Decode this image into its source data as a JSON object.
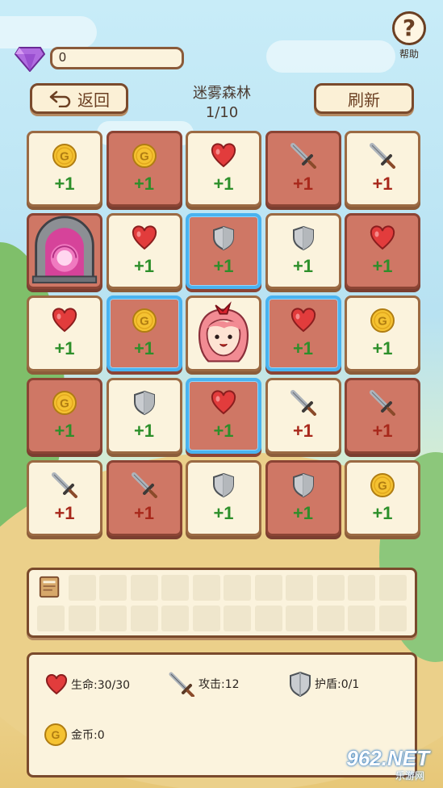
{
  "header": {
    "gems": "0",
    "help_label": "帮助",
    "back_label": "返回",
    "refresh_label": "刷新",
    "level_name": "迷雾森林",
    "level_progress": "1/10"
  },
  "grid": {
    "rows": [
      [
        {
          "icon": "coin-icon",
          "value": "+1",
          "tone": "light",
          "selected": false,
          "kind": "good"
        },
        {
          "icon": "coin-icon",
          "value": "+1",
          "tone": "dark",
          "selected": false,
          "kind": "good"
        },
        {
          "icon": "heart-icon",
          "value": "+1",
          "tone": "light",
          "selected": false,
          "kind": "good"
        },
        {
          "icon": "sword-icon",
          "value": "+1",
          "tone": "dark",
          "selected": false,
          "kind": "bad"
        },
        {
          "icon": "sword-icon",
          "value": "+1",
          "tone": "light",
          "selected": false,
          "kind": "bad"
        }
      ],
      [
        {
          "icon": "portal-icon",
          "value": "",
          "tone": "dark",
          "selected": false,
          "kind": "none"
        },
        {
          "icon": "heart-icon",
          "value": "+1",
          "tone": "light",
          "selected": false,
          "kind": "good"
        },
        {
          "icon": "shield-icon",
          "value": "+1",
          "tone": "dark",
          "selected": true,
          "kind": "good"
        },
        {
          "icon": "shield-icon",
          "value": "+1",
          "tone": "light",
          "selected": false,
          "kind": "good"
        },
        {
          "icon": "heart-icon",
          "value": "+1",
          "tone": "dark",
          "selected": false,
          "kind": "good"
        }
      ],
      [
        {
          "icon": "heart-icon",
          "value": "+1",
          "tone": "light",
          "selected": false,
          "kind": "good"
        },
        {
          "icon": "coin-icon",
          "value": "+1",
          "tone": "dark",
          "selected": true,
          "kind": "good"
        },
        {
          "icon": "hero-icon",
          "value": "",
          "tone": "light",
          "selected": false,
          "kind": "none"
        },
        {
          "icon": "heart-icon",
          "value": "+1",
          "tone": "dark",
          "selected": true,
          "kind": "good"
        },
        {
          "icon": "coin-icon",
          "value": "+1",
          "tone": "light",
          "selected": false,
          "kind": "good"
        }
      ],
      [
        {
          "icon": "coin-icon",
          "value": "+1",
          "tone": "dark",
          "selected": false,
          "kind": "good"
        },
        {
          "icon": "shield-icon",
          "value": "+1",
          "tone": "light",
          "selected": false,
          "kind": "good"
        },
        {
          "icon": "heart-icon",
          "value": "+1",
          "tone": "dark",
          "selected": true,
          "kind": "good"
        },
        {
          "icon": "sword-icon",
          "value": "+1",
          "tone": "light",
          "selected": false,
          "kind": "bad"
        },
        {
          "icon": "sword-icon",
          "value": "+1",
          "tone": "dark",
          "selected": false,
          "kind": "bad"
        }
      ],
      [
        {
          "icon": "sword-icon",
          "value": "+1",
          "tone": "light",
          "selected": false,
          "kind": "bad"
        },
        {
          "icon": "sword-icon",
          "value": "+1",
          "tone": "dark",
          "selected": false,
          "kind": "bad"
        },
        {
          "icon": "shield-icon",
          "value": "+1",
          "tone": "light",
          "selected": false,
          "kind": "good"
        },
        {
          "icon": "shield-icon",
          "value": "+1",
          "tone": "dark",
          "selected": false,
          "kind": "good"
        },
        {
          "icon": "coin-icon",
          "value": "+1",
          "tone": "light",
          "selected": false,
          "kind": "good"
        }
      ]
    ]
  },
  "inventory": {
    "items": [
      {
        "icon": "book-icon"
      }
    ],
    "slot_rows": 2,
    "slot_cols": 12
  },
  "stats": {
    "hp": "生命:30/30",
    "attack": "攻击:12",
    "shield": "护盾:0/1",
    "gold": "金币:0"
  },
  "watermark": {
    "text": "962.NET",
    "sub": "乐游网"
  },
  "colors": {
    "good": "#2d8f2a",
    "bad": "#a8281b",
    "selected_border": "#49b3f0",
    "tile_light": "#fbf3dd",
    "tile_dark": "#cf7765"
  }
}
